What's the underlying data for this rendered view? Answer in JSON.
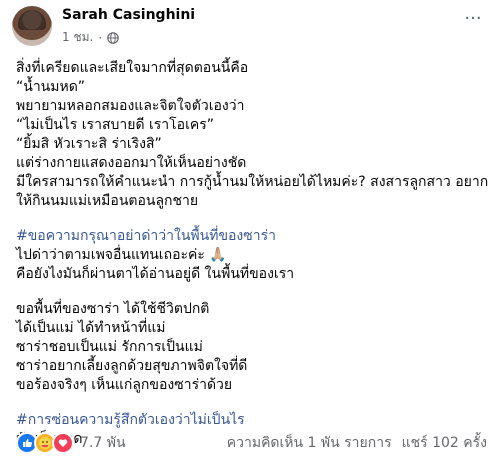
{
  "post": {
    "author": "Sarah Casinghini",
    "time": "1 ชม.",
    "more": "···",
    "body": [
      {
        "text": "สิ่งที่เครียดและเสียใจมากที่สุดตอนนี้คือ",
        "type": "text"
      },
      {
        "text": "“น้ำนมหด”",
        "type": "text"
      },
      {
        "text": "พยายามหลอกสมองและจิตใจตัวเองว่า",
        "type": "text"
      },
      {
        "text": "“ไม่เป็นไร เราสบายดี เราโอเคร”",
        "type": "text"
      },
      {
        "text": "“ยิ้มสิ หัวเราะสิ ร่าเริงสิ”",
        "type": "text"
      },
      {
        "text": "แต่ร่างกายแสดงออกมาให้เห็นอย่างชัด",
        "type": "text"
      },
      {
        "text": "มีใครสามารถให้คำแนะนำ การกู้น้ำนมให้หน่อยได้ไหมค่ะ? สงสารลูกสาว อยาก",
        "type": "text"
      },
      {
        "text": "ให้กินนมแม่เหมือนตอนลูกชาย",
        "type": "text"
      },
      {
        "type": "gap"
      },
      {
        "text": "#ขอความกรุณาอย่าด่าว่าในพื้นที่ของซาร่า",
        "type": "hashtag"
      },
      {
        "text": "ไปด่าว่าตามเพจอื่นแทนเถอะค่ะ 🙏🏼",
        "type": "text"
      },
      {
        "text": "คือยังไงมันก็ผ่านตาได้อ่านอยู่ดี ในพื้นที่ของเรา",
        "type": "text"
      },
      {
        "type": "gap"
      },
      {
        "text": "ขอพื้นที่ของซาร่า ได้ใช้ชีวิตปกติ",
        "type": "text"
      },
      {
        "text": "ได้เป็นแม่ ได้ทำหน้าที่แม่",
        "type": "text"
      },
      {
        "text": "ซาร่าชอบเป็นแม่ รักการเป็นแม่",
        "type": "text"
      },
      {
        "text": "ซาร่าอยากเลี้ยงลูกด้วยสุขภาพจิตใจที่ดี",
        "type": "text"
      },
      {
        "text": "ขอร้องจริงๆ เห็นแก่ลูกของซาร่าด้วย",
        "type": "text"
      },
      {
        "type": "gap"
      },
      {
        "text": "#การซ่อนความรู้สึกตัวเองว่าไม่เป็นไร",
        "type": "hashtag"
      },
      {
        "text": "มันเจ็บปวด",
        "type": "text"
      }
    ]
  },
  "footer": {
    "reaction_count": "7.7 พัน",
    "comments": "ความคิดเห็น 1 พัน รายการ",
    "shares": "แชร์ 102 ครั้ง"
  },
  "colors": {
    "hashtag": "#385898",
    "like": "#1877f2",
    "care": "#f7b125",
    "love": "#f33e58"
  },
  "icons": [
    "globe-icon",
    "like-icon",
    "care-icon",
    "love-icon",
    "more-icon"
  ]
}
